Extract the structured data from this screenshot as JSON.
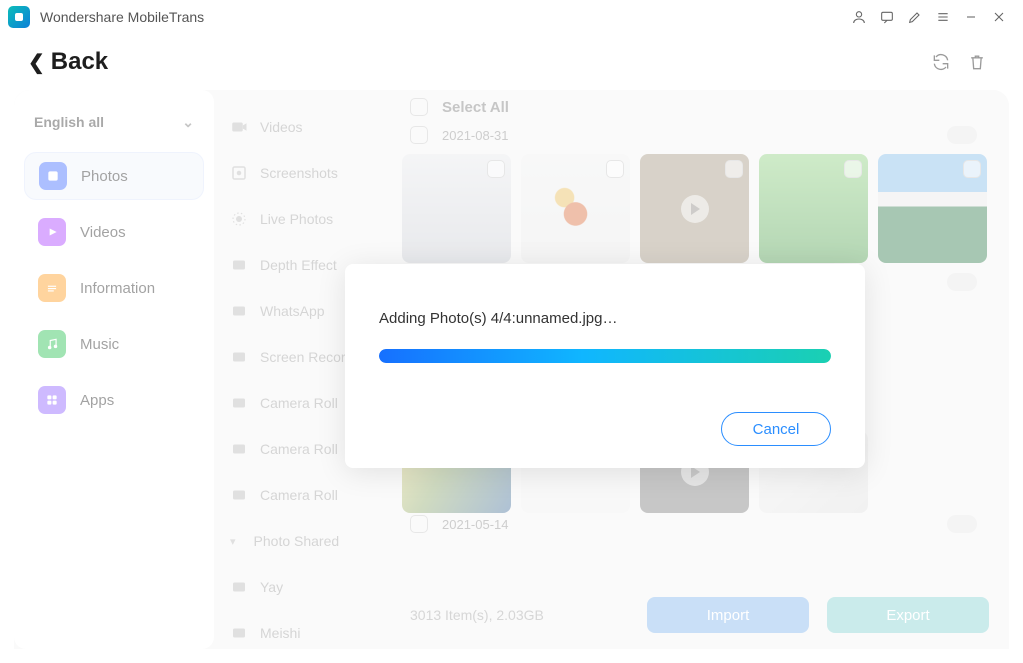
{
  "app": {
    "title": "Wondershare MobileTrans"
  },
  "header": {
    "back_label": "Back"
  },
  "sidebar": {
    "language_label": "English all",
    "items": [
      {
        "label": "Photos"
      },
      {
        "label": "Videos"
      },
      {
        "label": "Information"
      },
      {
        "label": "Music"
      },
      {
        "label": "Apps"
      }
    ]
  },
  "midcol": {
    "items": [
      {
        "label": "Videos"
      },
      {
        "label": "Screenshots"
      },
      {
        "label": "Live Photos"
      },
      {
        "label": "Depth Effect"
      },
      {
        "label": "WhatsApp"
      },
      {
        "label": "Screen Recorder"
      },
      {
        "label": "Camera Roll"
      },
      {
        "label": "Camera Roll"
      },
      {
        "label": "Camera Roll"
      },
      {
        "label": "Photo Shared"
      },
      {
        "label": "Yay"
      },
      {
        "label": "Meishi"
      }
    ]
  },
  "content": {
    "select_all_label": "Select All",
    "groups": [
      {
        "date": "2021-08-31"
      },
      {
        "date": "2021-05-14"
      }
    ]
  },
  "footer": {
    "summary": "3013 Item(s), 2.03GB",
    "import_label": "Import",
    "export_label": "Export"
  },
  "modal": {
    "message": "Adding Photo(s) 4/4:unnamed.jpg…",
    "progress_percent": 100,
    "cancel_label": "Cancel"
  },
  "colors": {
    "accent_blue": "#2b8eff",
    "progress_gradient_from": "#1670ff",
    "progress_gradient_to": "#1ad0b2"
  }
}
